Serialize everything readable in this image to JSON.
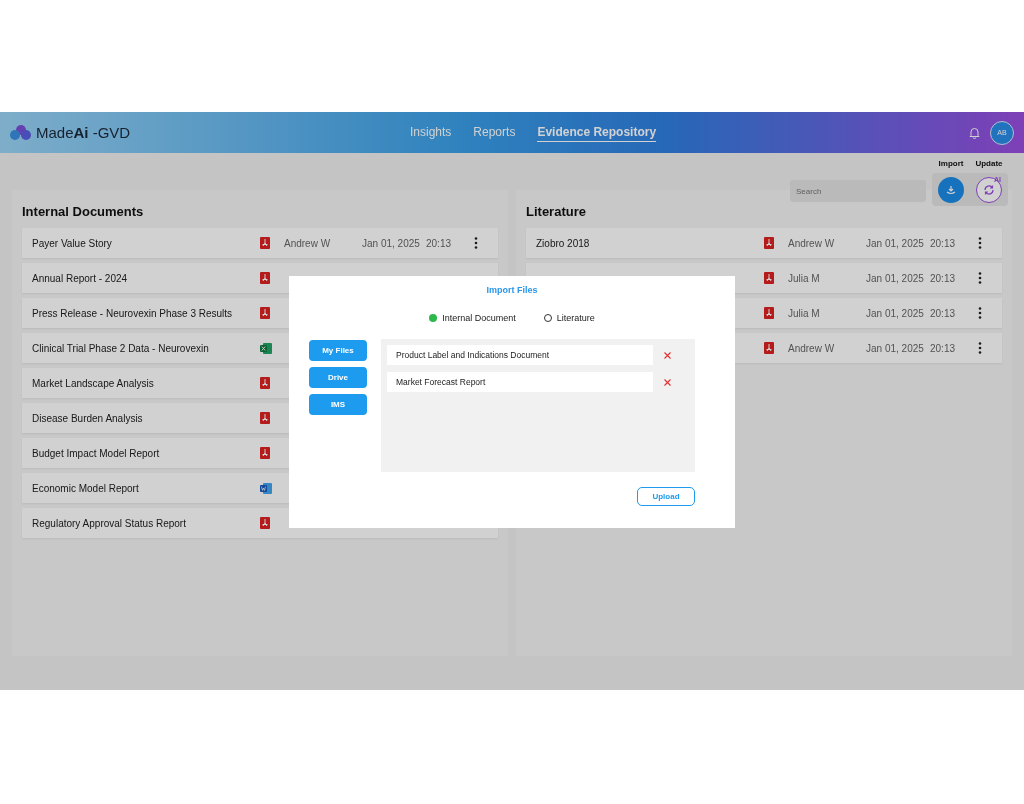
{
  "header": {
    "logo": "Made**Ai** -GVD",
    "nav": [
      {
        "label": "Insights",
        "selected": false
      },
      {
        "label": "Reports",
        "selected": false
      },
      {
        "label": "Evidence Repository",
        "selected": true
      }
    ],
    "avatar": "AB"
  },
  "toolbar": {
    "search": {
      "placeholder": "Search"
    },
    "actions": [
      {
        "label": "Import",
        "kind": "import"
      },
      {
        "label": "Update",
        "kind": "update",
        "badge": "AI"
      }
    ]
  },
  "internal_documents": {
    "title": "Internal Documents",
    "rows": [
      {
        "title": "Payer Value Story",
        "kind": "pdf",
        "author": "Andrew W",
        "date": "Jan 01, 2025",
        "time": "20:13"
      },
      {
        "title": "Annual Report - 2024",
        "kind": "pdf"
      },
      {
        "title": "Press Release - Neurovexin Phase 3  Results",
        "kind": "pdf"
      },
      {
        "title": "Clinical Trial Phase 2 Data - Neurovexin",
        "kind": "excel"
      },
      {
        "title": "Market Landscape Analysis",
        "kind": "pdf"
      },
      {
        "title": "Disease Burden Analysis",
        "kind": "pdf"
      },
      {
        "title": "Budget Impact Model Report",
        "kind": "pdf"
      },
      {
        "title": "Economic Model Report",
        "kind": "word"
      },
      {
        "title": "Regulatory Approval Status Report",
        "kind": "pdf"
      }
    ]
  },
  "literature": {
    "title": "Literature",
    "rows": [
      {
        "title": "Ziobro 2018",
        "kind": "pdf",
        "author": "Andrew W",
        "date": "Jan 01, 2025",
        "time": "20:13"
      },
      {
        "kind": "pdf",
        "author": "Julia M",
        "date": "Jan 01, 2025",
        "time": "20:13"
      },
      {
        "kind": "pdf",
        "author": "Julia M",
        "date": "Jan 01, 2025",
        "time": "20:13"
      },
      {
        "kind": "pdf",
        "author": "Andrew W",
        "date": "Jan 01, 2025",
        "time": "20:13"
      }
    ]
  },
  "modal": {
    "title": "Import Files",
    "radios": [
      {
        "label": "Internal Document",
        "selected": true
      },
      {
        "label": "Literature",
        "selected": false
      }
    ],
    "sources": [
      "My Files",
      "Drive",
      "IMS"
    ],
    "files": [
      {
        "name": "Product Label and Indications Document"
      },
      {
        "name": "Market Forecast Report"
      }
    ],
    "upload": "Upload"
  }
}
